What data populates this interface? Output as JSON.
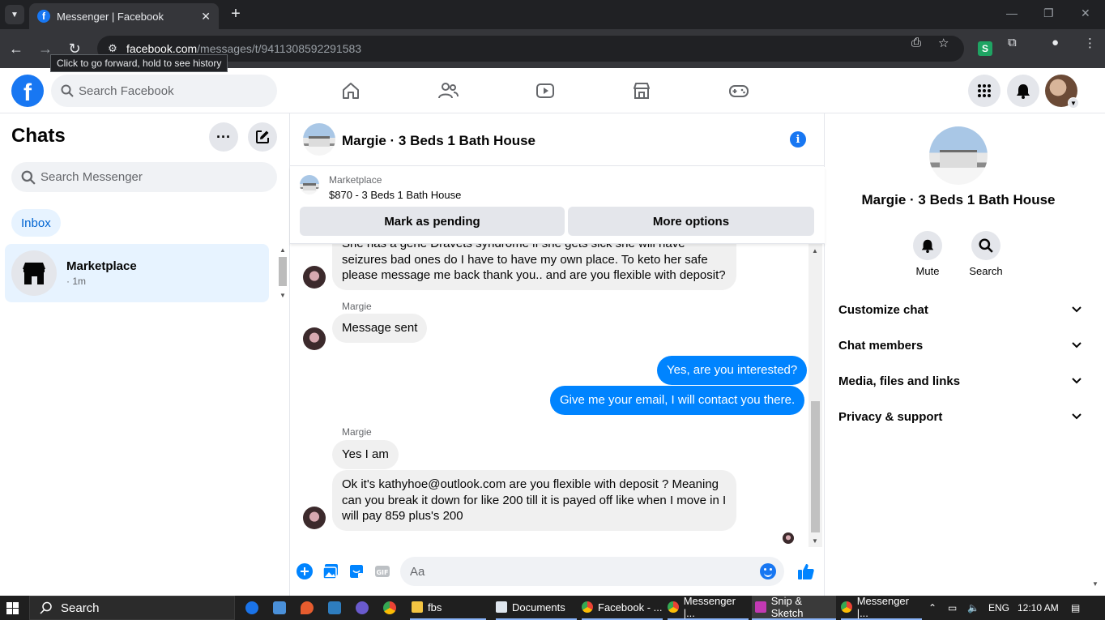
{
  "browser": {
    "tab_title": "Messenger | Facebook",
    "url_host": "facebook.com",
    "url_path": "/messages/t/9411308592291583",
    "tooltip": "Click to go forward, hold to see history"
  },
  "fb": {
    "search_placeholder": "Search Facebook"
  },
  "sidebar": {
    "title": "Chats",
    "search_placeholder": "Search Messenger",
    "filter": "Inbox",
    "chats": [
      {
        "name": "Marketplace",
        "time": "· 1m"
      }
    ]
  },
  "conversation": {
    "title": "Margie · 3 Beds 1 Bath House",
    "marketplace_label": "Marketplace",
    "listing": "$870 - 3 Beds 1 Bath House",
    "btn_pending": "Mark as pending",
    "btn_more": "More options",
    "messages": [
      {
        "dir": "in",
        "text": "She has a gene Dravets syndrome if she gets sick she will have seizures bad ones do I have to have my own place. To keto her safe please message me back thank you.. and are you flexible with deposit?"
      },
      {
        "dir": "in",
        "sender": "Margie",
        "text": "Message sent"
      },
      {
        "dir": "out",
        "text": "Yes, are you interested?"
      },
      {
        "dir": "out",
        "text": "Give me your email, I will contact you there."
      },
      {
        "dir": "in",
        "sender": "Margie",
        "text": "Yes I am"
      },
      {
        "dir": "in",
        "text": "Ok it's kathyhoe@outlook.com are you flexible with deposit ? Meaning can you break it down for like 200 till it is payed off like when I move in I will pay 859 plus's 200"
      }
    ],
    "composer_placeholder": "Aa"
  },
  "right_panel": {
    "name": "Margie · 3 Beds 1 Bath House",
    "actions": [
      {
        "label": "Mute"
      },
      {
        "label": "Search"
      }
    ],
    "sections": [
      {
        "label": "Customize chat"
      },
      {
        "label": "Chat members"
      },
      {
        "label": "Media, files and links"
      },
      {
        "label": "Privacy & support"
      }
    ]
  },
  "taskbar": {
    "search": "Search",
    "apps": [
      {
        "label": "fbs"
      },
      {
        "label": "Documents"
      },
      {
        "label": "Facebook - ..."
      },
      {
        "label": "Messenger |..."
      },
      {
        "label": "Snip & Sketch"
      },
      {
        "label": "Messenger |..."
      }
    ],
    "language": "ENG",
    "time": "12:10 AM"
  },
  "colors": {
    "fb_blue": "#1877f2",
    "outgoing_bubble": "#0084ff",
    "incoming_bubble": "#f0f0f0",
    "selected_chat": "#e7f3ff"
  }
}
